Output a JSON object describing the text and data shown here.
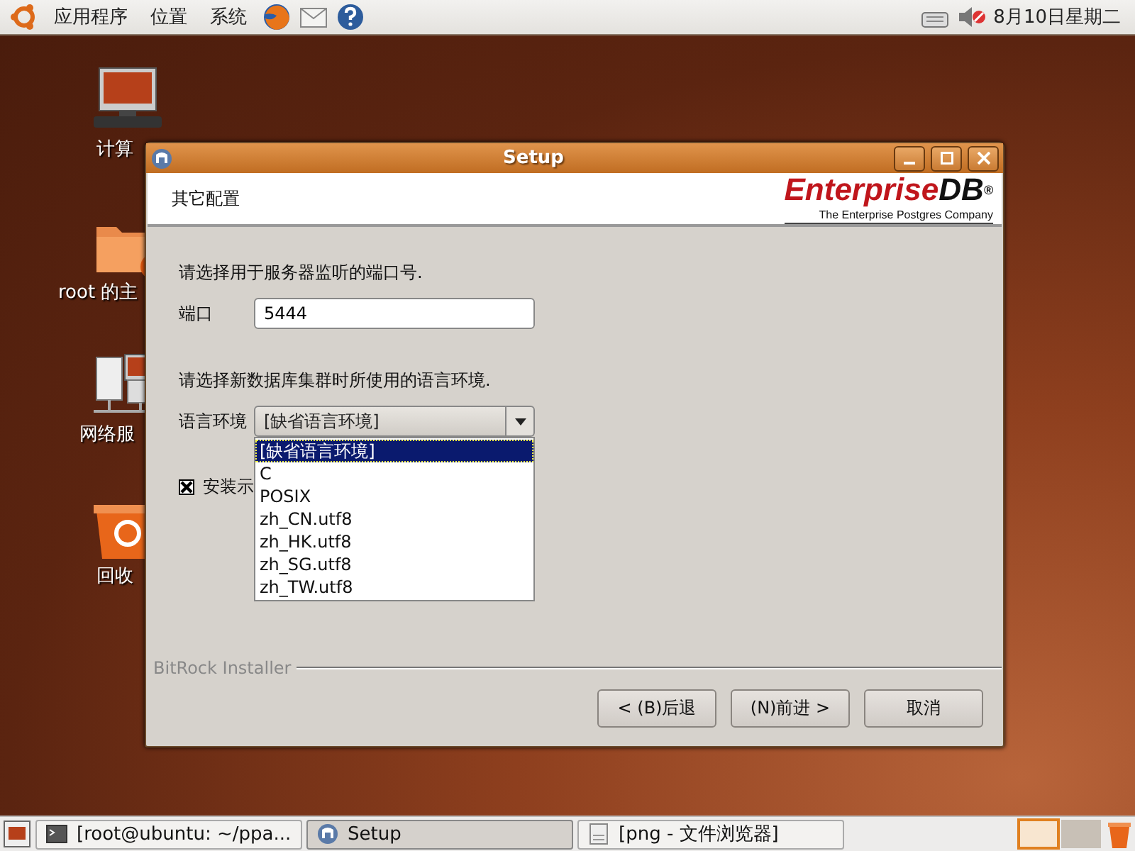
{
  "top_panel": {
    "menus": [
      "应用程序",
      "位置",
      "系统"
    ],
    "clock": "8月10日星期二"
  },
  "desktop_icons": [
    {
      "label": "计算",
      "kind": "computer"
    },
    {
      "label": "root 的主",
      "kind": "home"
    },
    {
      "label": "网络服",
      "kind": "network"
    },
    {
      "label": "回收",
      "kind": "trash"
    }
  ],
  "window": {
    "title": "Setup",
    "header": "其它配置",
    "logo": "Enterprise",
    "logo_suffix": "DB",
    "logo_mark": "®",
    "tagline": "The Enterprise Postgres Company",
    "port_prompt": "请选择用于服务器监听的端口号.",
    "port_label": "端口",
    "port_value": "5444",
    "locale_prompt": "请选择新数据库集群时所使用的语言环境.",
    "locale_label": "语言环境",
    "locale_value": "[缺省语言环境]",
    "locale_options": [
      {
        "label": "[缺省语言环境]",
        "selected": true
      },
      {
        "label": "C",
        "selected": false
      },
      {
        "label": "POSIX",
        "selected": false
      },
      {
        "label": "zh_CN.utf8",
        "selected": false
      },
      {
        "label": "zh_HK.utf8",
        "selected": false
      },
      {
        "label": "zh_SG.utf8",
        "selected": false
      },
      {
        "label": "zh_TW.utf8",
        "selected": false
      }
    ],
    "sample_checkbox": {
      "label": "安装示",
      "checked": true
    },
    "footer_brand": "BitRock Installer",
    "buttons": [
      "< (B)后退",
      "(N)前进 >",
      "取消"
    ]
  },
  "taskbar": {
    "tasks": [
      {
        "label": "[root@ubuntu: ~/ppa...",
        "kind": "terminal",
        "selected": false
      },
      {
        "label": "Setup",
        "kind": "setup",
        "selected": true
      },
      {
        "label": "[png - 文件浏览器]",
        "kind": "files",
        "selected": false
      }
    ]
  }
}
